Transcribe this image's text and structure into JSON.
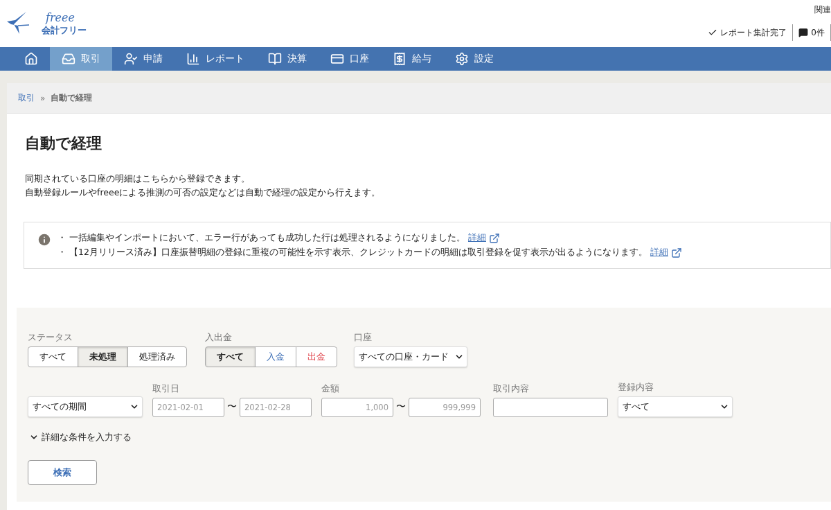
{
  "header": {
    "logo_script": "freee",
    "logo_text": "会計フリー",
    "top_link": "関連",
    "report_status": "レポート集計完了",
    "comments": "0件"
  },
  "nav": [
    {
      "kind": "home",
      "selected": false
    },
    {
      "kind": "inbox",
      "label": "取引",
      "selected": true
    },
    {
      "kind": "user-check",
      "label": "申請",
      "selected": false
    },
    {
      "kind": "chart",
      "label": "レポート",
      "selected": false
    },
    {
      "kind": "book",
      "label": "決算",
      "selected": false
    },
    {
      "kind": "card",
      "label": "口座",
      "selected": false
    },
    {
      "kind": "receipt",
      "label": "給与",
      "selected": false
    },
    {
      "kind": "gear",
      "label": "設定",
      "selected": false
    }
  ],
  "breadcrumb": {
    "parent": "取引",
    "separator": "»",
    "current": "自動で経理"
  },
  "page": {
    "title": "自動で経理",
    "description": [
      "同期されている口座の明細はこちらから登録できます。",
      "自動登録ルールやfreeeによる推測の可否の設定などは自動で経理の設定から行えます。"
    ]
  },
  "notices": [
    {
      "bullet": "・",
      "text": "一括編集やインポートにおいて、エラー行があっても成功した行は処理されるようになりました。",
      "link": "詳細"
    },
    {
      "bullet": "・",
      "text": "【12月リリース済み】口座振替明細の登録に重複の可能性を示す表示、クレジットカードの明細は取引登録を促す表示が出るようになります。",
      "link": "詳細"
    }
  ],
  "filters": {
    "status": {
      "label": "ステータス",
      "options": [
        {
          "label": "すべて",
          "selected": false
        },
        {
          "label": "未処理",
          "selected": true
        },
        {
          "label": "処理済み",
          "selected": false
        }
      ]
    },
    "direction": {
      "label": "入出金",
      "options": [
        {
          "label": "すべて",
          "selected": true,
          "kind": "all"
        },
        {
          "label": "入金",
          "selected": false,
          "kind": "income"
        },
        {
          "label": "出金",
          "selected": false,
          "kind": "expense"
        }
      ]
    },
    "account": {
      "label": "口座",
      "value": "すべての口座・カード"
    },
    "period": {
      "value": "すべての期間"
    },
    "date": {
      "label": "取引日",
      "from_placeholder": "2021-02-01",
      "separator": "〜",
      "to_placeholder": "2021-02-28"
    },
    "amount": {
      "label": "金額",
      "from_placeholder": "1,000",
      "separator": "〜",
      "to_placeholder": "999,999"
    },
    "description": {
      "label": "取引内容"
    },
    "registration": {
      "label": "登録内容",
      "value": "すべて"
    },
    "advanced": {
      "label": "詳細な条件を入力する",
      "expanded": false
    },
    "search_button": "検索"
  }
}
